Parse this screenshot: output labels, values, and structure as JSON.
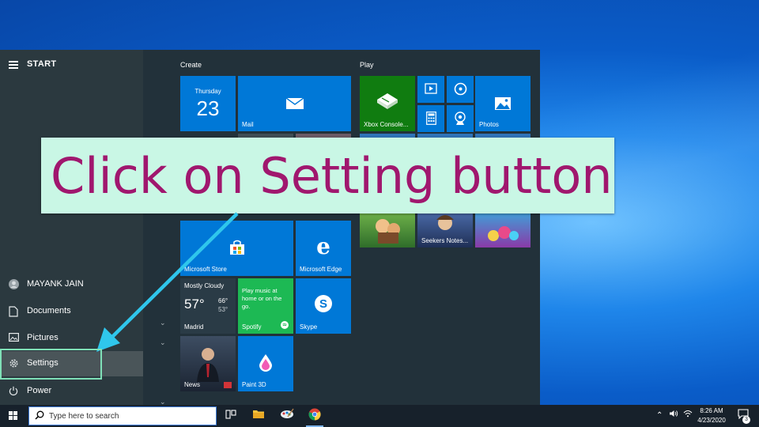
{
  "start_menu": {
    "title": "START",
    "user_name": "MAYANK JAIN",
    "items": {
      "documents": "Documents",
      "pictures": "Pictures",
      "settings": "Settings",
      "power": "Power"
    },
    "groups": {
      "create": "Create",
      "play": "Play"
    }
  },
  "tiles": {
    "calendar_day": "Thursday",
    "calendar_date": "23",
    "mail": "Mail",
    "xbox": "Xbox Console...",
    "photos": "Photos",
    "store": "Microsoft Store",
    "edge": "Microsoft Edge",
    "weather_condition": "Mostly Cloudy",
    "weather_temp": "57°",
    "weather_high": "66°",
    "weather_low": "53°",
    "weather_city": "Madrid",
    "spotify_text": "Play music at home or on the go.",
    "spotify": "Spotify",
    "skype": "Skype",
    "news": "News",
    "paint3d": "Paint 3D",
    "seekers": "Seekers Notes..."
  },
  "callout": {
    "text": "Click on Setting button"
  },
  "taskbar": {
    "search_placeholder": "Type here to search",
    "time": "8:26 AM",
    "date": "4/23/2020",
    "notification_count": "3"
  },
  "colors": {
    "tile_blue": "#0078d7",
    "xbox_green": "#107c10",
    "spotify_green": "#1db954",
    "callout_bg": "#c9f7e5",
    "callout_text": "#a0176e",
    "highlight": "#7fe0b7",
    "arrow": "#2fc6ec"
  }
}
